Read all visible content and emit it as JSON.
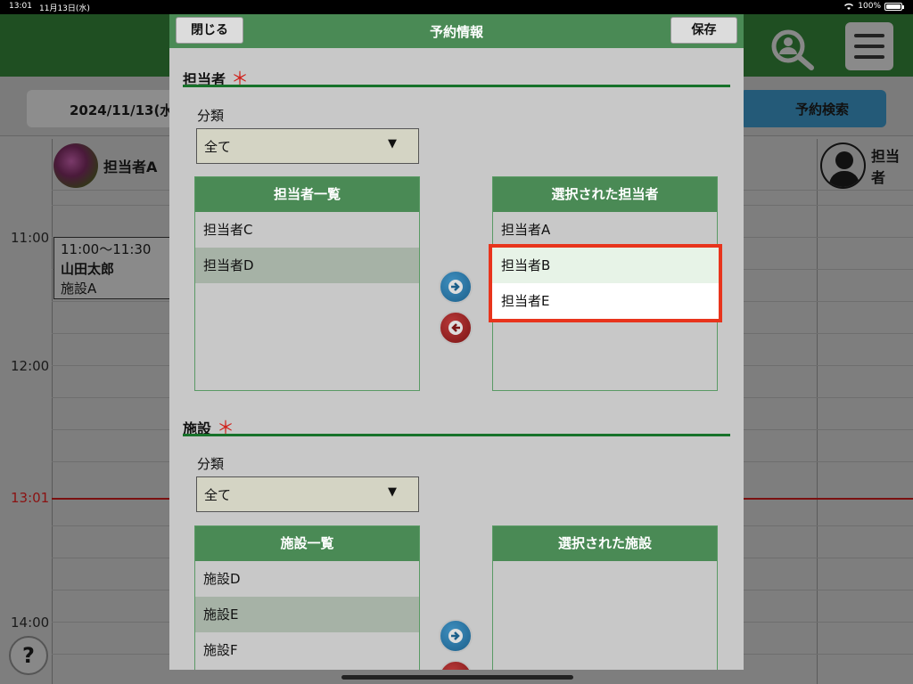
{
  "statusbar": {
    "time": "13:01",
    "date": "11月13日(水)",
    "battery": "100%"
  },
  "background": {
    "date": "2024/11/13(水",
    "search_button": "予約検索",
    "staff": [
      {
        "name": "担当者A",
        "avatar": "flower-photo"
      },
      {
        "name": "担当者",
        "avatar": "person-icon"
      }
    ],
    "times": [
      "11:00",
      "12:00",
      "13:01",
      "14:00"
    ],
    "event": {
      "time": "11:00～11:30",
      "name": "山田太郎",
      "place": "施設A"
    },
    "help": "?"
  },
  "modal": {
    "title": "予約情報",
    "close_label": "閉じる",
    "save_label": "保存",
    "staff_section": {
      "title": "担当者",
      "required_mark": "＊",
      "category_label": "分類",
      "category_value": "全て",
      "list_header": "担当者一覧",
      "list_items": [
        "担当者C",
        "担当者D"
      ],
      "selected_header": "選択された担当者",
      "selected_items": [
        "担当者A",
        "担当者B",
        "担当者E"
      ]
    },
    "facility_section": {
      "title": "施設",
      "required_mark": "＊",
      "category_label": "分類",
      "category_value": "全て",
      "list_header": "施設一覧",
      "list_items": [
        "施設D",
        "施設E",
        "施設F"
      ],
      "selected_header": "選択された施設"
    }
  },
  "colors": {
    "accent": "#4a8a55",
    "rule": "#17722a",
    "highlight": "#e8341c",
    "required": "#d0201a"
  }
}
